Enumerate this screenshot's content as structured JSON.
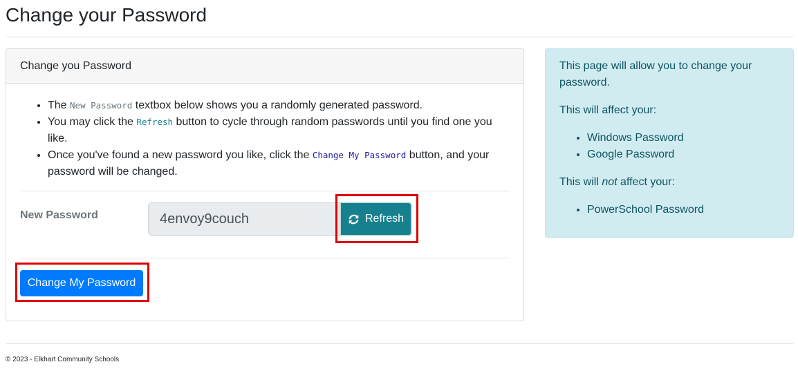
{
  "page": {
    "title": "Change your Password"
  },
  "card": {
    "header": "Change you Password",
    "instructions": {
      "item1": {
        "before": "The ",
        "code": "New Password",
        "after": " textbox below shows you a randomly generated password."
      },
      "item2": {
        "before": "You may click the ",
        "code": "Refresh",
        "after": " button to cycle through random passwords until you find one you like."
      },
      "item3": {
        "before": "Once you've found a new password you like, click the ",
        "code": "Change My Password",
        "after": " button, and your password will be changed."
      }
    },
    "password_label": "New Password",
    "password_value": "4envoy9couch",
    "refresh_label": "Refresh",
    "refresh_icon": "refresh-icon",
    "change_button_label": "Change My Password"
  },
  "info": {
    "intro": "This page will allow you to change your password.",
    "affects_heading": "This will affect your:",
    "affects": [
      "Windows Password",
      "Google Password"
    ],
    "not_affects_before": "This will ",
    "not_affects_em": "not",
    "not_affects_after": " affect your:",
    "not_affects": [
      "PowerSchool Password"
    ]
  },
  "footer": {
    "text": "© 2023 - Elkhart Community Schools"
  },
  "colors": {
    "primary": "#007bff",
    "refresh": "#17808e",
    "info_bg": "#d1ecf1",
    "info_text": "#0c5460",
    "highlight": "#e00000"
  }
}
